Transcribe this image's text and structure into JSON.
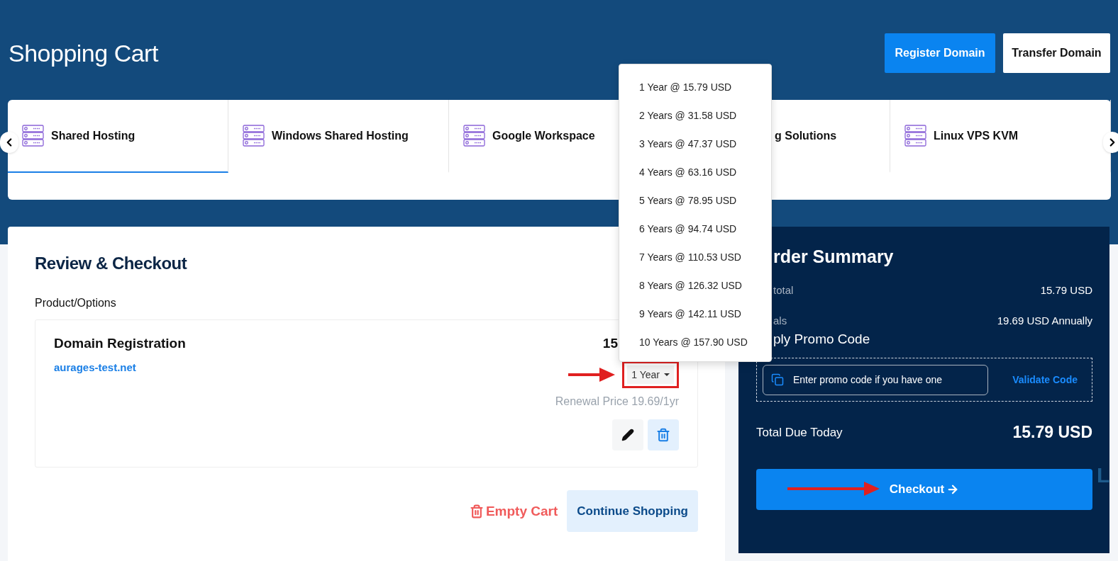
{
  "header": {
    "title": "Shopping Cart",
    "buttons": [
      {
        "label": "Register Domain",
        "kind": "primary"
      },
      {
        "label": "Transfer Domain",
        "kind": "secondary"
      }
    ]
  },
  "categories": [
    {
      "label": "Shared Hosting",
      "selected": true,
      "clipped": false
    },
    {
      "label": "Windows Shared Hosting",
      "selected": false,
      "clipped": false
    },
    {
      "label": "Google Workspace",
      "selected": false,
      "clipped": false
    },
    {
      "label": "g Solutions",
      "selected": false,
      "clipped": true
    },
    {
      "label": "Linux VPS KVM",
      "selected": false,
      "clipped": false
    }
  ],
  "review": {
    "title": "Review & Checkout",
    "section_label": "Product/Options",
    "item": {
      "name": "Domain Registration",
      "domain": "aurages-test.net",
      "price": "15",
      "period": {
        "value": "1 Year",
        "expanded": true
      },
      "renewal": "Renewal Price 19.69/1yr"
    },
    "empty_cart": "Empty Cart",
    "continue": "Continue Shopping"
  },
  "period_menu": [
    "1 Year @ 15.79 USD",
    "2 Years @ 31.58 USD",
    "3 Years @ 47.37 USD",
    "4 Years @ 63.16 USD",
    "5 Years @ 78.95 USD",
    "6 Years @ 94.74 USD",
    "7 Years @ 110.53 USD",
    "8 Years @ 126.32 USD",
    "9 Years @ 142.11 USD",
    "10 Years @ 157.90 USD"
  ],
  "summary": {
    "title": "rder Summary",
    "rows": [
      {
        "label": "total",
        "value": "15.79 USD"
      },
      {
        "label": "als",
        "value": "19.69 USD Annually"
      }
    ],
    "promo": {
      "title": "ply Promo Code",
      "placeholder": "Enter promo code if you have one",
      "button": "Validate Code"
    },
    "total": {
      "label": "Total Due Today",
      "value": "15.79 USD"
    },
    "checkout": "Checkout"
  },
  "background_text": "L"
}
